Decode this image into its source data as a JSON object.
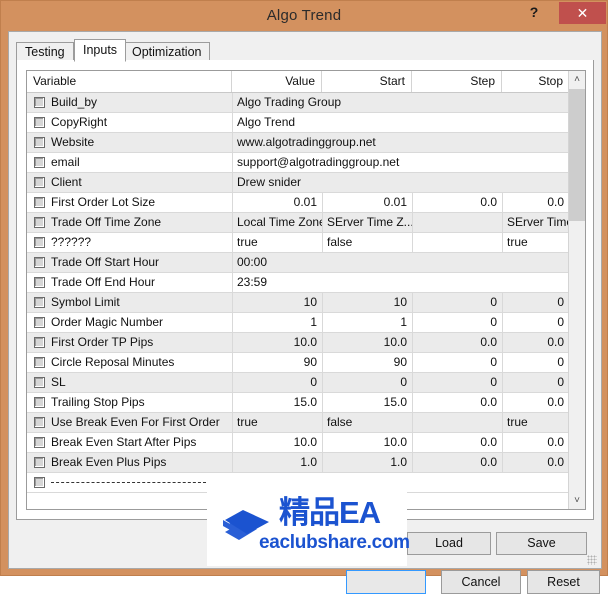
{
  "window": {
    "title": "Algo Trend",
    "help_label": "?",
    "close_label": "✕"
  },
  "tabs": [
    {
      "label": "Testing",
      "active": false
    },
    {
      "label": "Inputs",
      "active": true
    },
    {
      "label": "Optimization",
      "active": false
    }
  ],
  "grid": {
    "columns": [
      "Variable",
      "Value",
      "Start",
      "Step",
      "Stop"
    ],
    "rows": [
      {
        "variable": "Build_by",
        "value": "Algo Trading Group",
        "start": "",
        "step": "",
        "stop": "",
        "wide_value": true
      },
      {
        "variable": "CopyRight",
        "value": "Algo Trend",
        "start": "",
        "step": "",
        "stop": "",
        "wide_value": true
      },
      {
        "variable": "Website",
        "value": "www.algotradinggroup.net",
        "start": "",
        "step": "",
        "stop": "",
        "wide_value": true
      },
      {
        "variable": "email",
        "value": "support@algotradinggroup.net",
        "start": "",
        "step": "",
        "stop": "",
        "wide_value": true
      },
      {
        "variable": "Client",
        "value": "Drew snider",
        "start": "",
        "step": "",
        "stop": "",
        "wide_value": true
      },
      {
        "variable": "First Order Lot Size",
        "value": "0.01",
        "start": "0.01",
        "step": "0.0",
        "stop": "0.0",
        "numeric": true
      },
      {
        "variable": "Trade Off Time Zone",
        "value": "Local Time Zone",
        "start": "SErver Time Z...",
        "step": "",
        "stop": "SErver Time Z..."
      },
      {
        "variable": "??????",
        "value": "true",
        "start": "false",
        "step": "",
        "stop": "true"
      },
      {
        "variable": "Trade Off Start Hour",
        "value": "00:00",
        "start": "",
        "step": "",
        "stop": "",
        "wide_value": true
      },
      {
        "variable": "Trade Off End Hour",
        "value": "23:59",
        "start": "",
        "step": "",
        "stop": "",
        "wide_value": true
      },
      {
        "variable": "Symbol Limit",
        "value": "10",
        "start": "10",
        "step": "0",
        "stop": "0",
        "numeric": true
      },
      {
        "variable": "Order Magic Number",
        "value": "1",
        "start": "1",
        "step": "0",
        "stop": "0",
        "numeric": true
      },
      {
        "variable": "First Order TP Pips",
        "value": "10.0",
        "start": "10.0",
        "step": "0.0",
        "stop": "0.0",
        "numeric": true
      },
      {
        "variable": "Circle Reposal Minutes",
        "value": "90",
        "start": "90",
        "step": "0",
        "stop": "0",
        "numeric": true
      },
      {
        "variable": "SL",
        "value": "0",
        "start": "0",
        "step": "0",
        "stop": "0",
        "numeric": true
      },
      {
        "variable": "Trailing Stop Pips",
        "value": "15.0",
        "start": "15.0",
        "step": "0.0",
        "stop": "0.0",
        "numeric": true
      },
      {
        "variable": "Use Break Even For First Order",
        "value": "true",
        "start": "false",
        "step": "",
        "stop": "true"
      },
      {
        "variable": "Break Even Start After Pips",
        "value": "10.0",
        "start": "10.0",
        "step": "0.0",
        "stop": "0.0",
        "numeric": true
      },
      {
        "variable": "Break Even Plus Pips",
        "value": "1.0",
        "start": "1.0",
        "step": "0.0",
        "stop": "0.0",
        "numeric": true
      },
      {
        "variable": "",
        "value": "",
        "start": "",
        "step": "",
        "stop": "",
        "separator": true
      }
    ],
    "scroll_up_glyph": "˄",
    "scroll_down_glyph": "˅"
  },
  "buttons": {
    "load": "Load",
    "save": "Save",
    "ok": "",
    "cancel": "Cancel",
    "reset": "Reset"
  },
  "watermark": {
    "brand_cn": "精品EA",
    "url": "eaclubshare.com",
    "color": "#1b53d0"
  },
  "colors": {
    "titlebar": "#d3915f",
    "close_button": "#c0504d",
    "row_alt": "#ebebeb",
    "default_button_border": "#3399ff"
  }
}
